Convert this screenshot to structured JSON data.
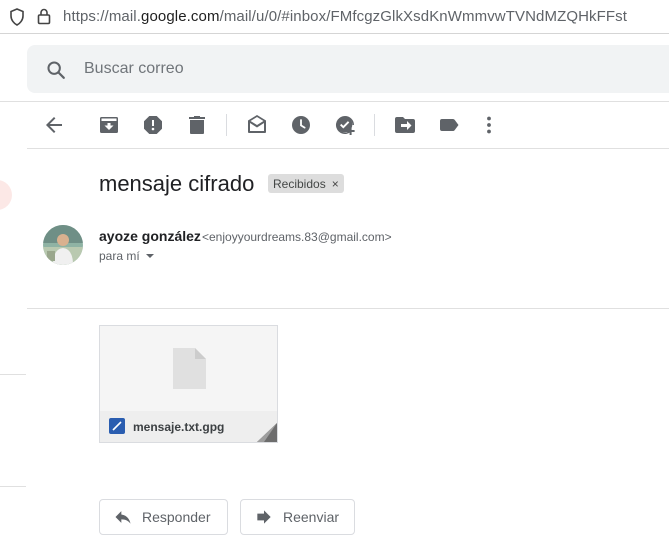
{
  "browser": {
    "url_prefix": "https://mail.",
    "url_domain": "google.com",
    "url_rest": "/mail/u/0/#inbox/FMfcgzGlkXsdKnWmmvwTVNdMZQHkFFst"
  },
  "search": {
    "placeholder": "Buscar correo"
  },
  "toolbar": {
    "icons": [
      "back-icon",
      "archive-icon",
      "report-spam-icon",
      "delete-icon",
      "mark-unread-icon",
      "snooze-icon",
      "add-task-icon",
      "move-to-icon",
      "label-icon",
      "more-icon"
    ]
  },
  "message": {
    "subject": "mensaje cifrado",
    "label": "Recibidos",
    "label_remove": "×",
    "sender_name": "ayoze gonzález",
    "sender_email": "<enjoyyourdreams.83@gmail.com>",
    "to": "para mí"
  },
  "attachment": {
    "filename": "mensaje.txt.gpg"
  },
  "actions": {
    "reply": "Responder",
    "forward": "Reenviar"
  },
  "colors": {
    "search_bg": "#f1f3f4",
    "icon": "#5f6368",
    "chip_bg": "#dddddd",
    "file_icon": "#2a5db0"
  }
}
